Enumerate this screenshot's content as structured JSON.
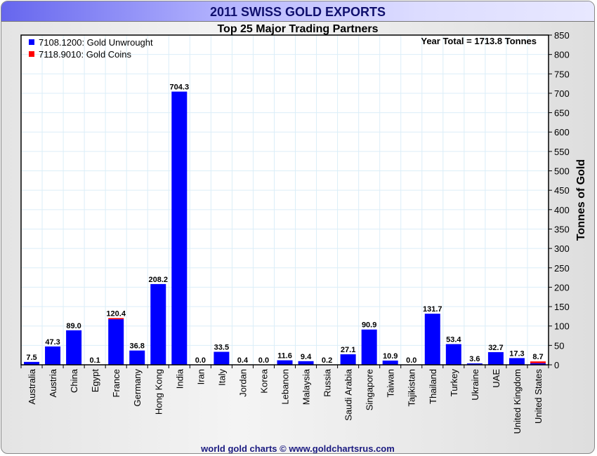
{
  "header": {
    "title": "2011 SWISS GOLD EXPORTS",
    "subtitle": "Top 25 Major Trading Partners",
    "footer": "world gold charts © www.goldchartsrus.com"
  },
  "chart_data": {
    "type": "bar",
    "stacked": true,
    "title": "Top 25 Major Trading Partners",
    "annotation": "Year Total = 1713.8 Tonnes",
    "xlabel": "",
    "ylabel": "Tonnes of Gold",
    "ylim": [
      0,
      850
    ],
    "ytick_step": 50,
    "grid": true,
    "legend_position": "top-left",
    "categories": [
      "Australia",
      "Austria",
      "China",
      "Egypt",
      "France",
      "Germany",
      "Hong Kong",
      "India",
      "Iran",
      "Italy",
      "Jordan",
      "Korea",
      "Lebanon",
      "Malaysia",
      "Russia",
      "Saudi Arabia",
      "Singapore",
      "Taiwan",
      "Tajikistan",
      "Thailand",
      "Turkey",
      "Ukraine",
      "UAE",
      "United Kingdom",
      "United States"
    ],
    "totals": [
      7.5,
      47.3,
      89.0,
      0.1,
      120.4,
      36.8,
      208.2,
      704.3,
      0.0,
      33.5,
      0.4,
      0.0,
      11.6,
      9.4,
      0.2,
      27.1,
      90.9,
      10.9,
      0.0,
      131.7,
      53.4,
      3.6,
      32.7,
      17.3,
      8.7
    ],
    "series": [
      {
        "name": "7108.1200: Gold Unwrought",
        "color": "#0000ff",
        "values": [
          7.5,
          47.3,
          89.0,
          0.1,
          117.4,
          36.8,
          208.2,
          704.3,
          0.0,
          33.5,
          0.4,
          0.0,
          11.6,
          9.4,
          0.2,
          27.1,
          90.9,
          10.9,
          0.0,
          131.7,
          53.4,
          3.6,
          32.7,
          17.3,
          4.2
        ]
      },
      {
        "name": "7118.9010: Gold Coins",
        "color": "#ff0000",
        "values": [
          0,
          0,
          0,
          0,
          3.0,
          0,
          0,
          0,
          0,
          0,
          0,
          0,
          0,
          0,
          0,
          0,
          0,
          0,
          0,
          0,
          0,
          0,
          0,
          0,
          4.5
        ]
      }
    ]
  }
}
